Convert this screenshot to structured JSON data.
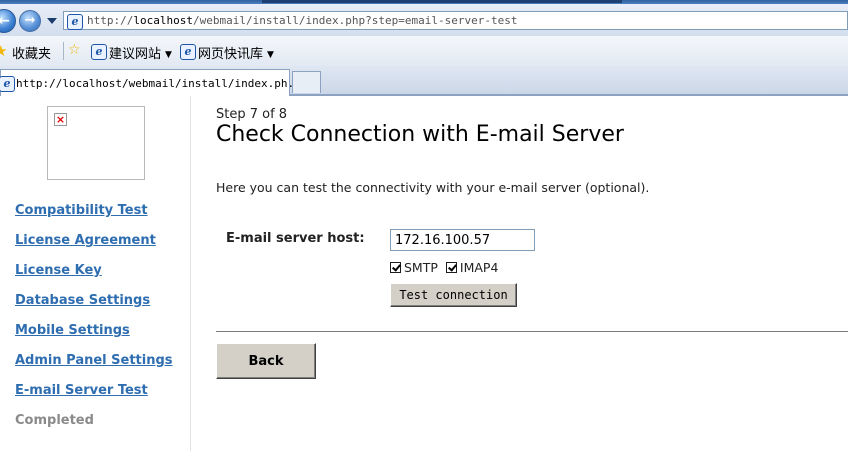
{
  "browser": {
    "address": {
      "prefix": "http://",
      "host": "localhost",
      "path": "/webmail/install/index.php?step=email-server-test"
    },
    "favorites": {
      "label": "收藏夹",
      "links": [
        "建议网站",
        "网页快讯库"
      ]
    },
    "tab": {
      "title": "http://localhost/webmail/install/index.ph..."
    }
  },
  "sidebar": {
    "items": [
      {
        "label": "Compatibility Test"
      },
      {
        "label": "License Agreement"
      },
      {
        "label": "License Key"
      },
      {
        "label": "Database Settings"
      },
      {
        "label": "Mobile Settings"
      },
      {
        "label": "Admin Panel Settings"
      },
      {
        "label": "E-mail Server Test"
      },
      {
        "label": "Completed"
      }
    ]
  },
  "main": {
    "step": "Step 7 of 8",
    "title": "Check Connection with E-mail Server",
    "description": "Here you can test the connectivity with your e-mail server (optional).",
    "host_label": "E-mail server host:",
    "host_value": "172.16.100.57",
    "smtp_label": "SMTP",
    "imap_label": "IMAP4",
    "test_button": "Test connection",
    "back_button": "Back"
  }
}
